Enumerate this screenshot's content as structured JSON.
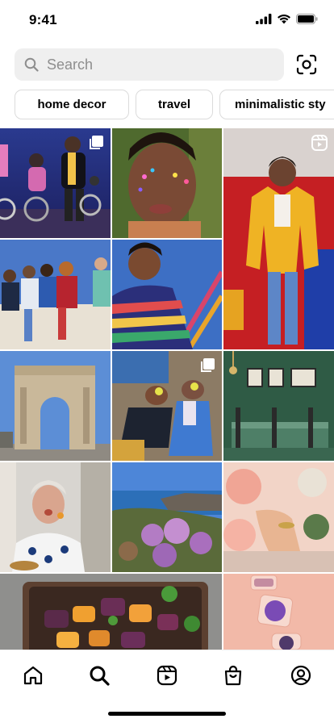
{
  "status_bar": {
    "time": "9:41",
    "icons": [
      "cellular-signal-icon",
      "wifi-icon",
      "battery-icon"
    ]
  },
  "search": {
    "placeholder": "Search",
    "search_icon": "search-icon",
    "scan_icon": "scan-icon"
  },
  "chips": [
    {
      "label": "home decor"
    },
    {
      "label": "travel"
    },
    {
      "label": "minimalistic sty"
    }
  ],
  "grid": {
    "tiles": [
      {
        "subject": "cyclists at dusk",
        "badge": "multiple-posts-icon"
      },
      {
        "subject": "portrait with face paint",
        "badge": ""
      },
      {
        "subject": "man in yellow jacket",
        "badge": "reels-icon"
      },
      {
        "subject": "group sitting on wall",
        "badge": ""
      },
      {
        "subject": "man in striped sweater",
        "badge": ""
      },
      {
        "subject": "stone arch monument",
        "badge": ""
      },
      {
        "subject": "two people lying on rock",
        "badge": "multiple-posts-icon"
      },
      {
        "subject": "green dining room",
        "badge": ""
      },
      {
        "subject": "woman eating",
        "badge": ""
      },
      {
        "subject": "coastal flowers",
        "badge": ""
      },
      {
        "subject": "hand and roses",
        "badge": ""
      },
      {
        "subject": "roasted vegetables tray",
        "badge": ""
      },
      {
        "subject": "glitter pots on pink",
        "badge": ""
      }
    ]
  },
  "bottom_nav": {
    "items": [
      {
        "icon": "home-icon",
        "active": false
      },
      {
        "icon": "search-icon",
        "active": true
      },
      {
        "icon": "reels-icon",
        "active": false
      },
      {
        "icon": "shop-icon",
        "active": false
      },
      {
        "icon": "profile-icon",
        "active": false
      }
    ]
  },
  "colors": {
    "search_bg": "#efefef",
    "placeholder": "#8e8e8e",
    "chip_border": "#dbdbdb",
    "text": "#000000"
  }
}
